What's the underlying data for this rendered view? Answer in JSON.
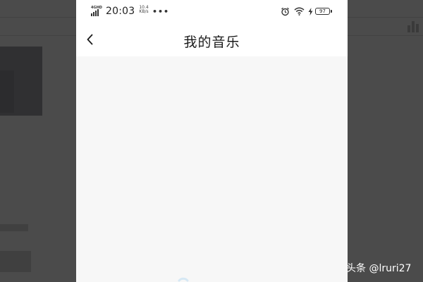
{
  "status_bar": {
    "network_type": "4GHD",
    "time": "20:03",
    "net_speed_value": "10.4",
    "net_speed_unit": "KB/s",
    "more": "•••",
    "battery_level": "97"
  },
  "nav": {
    "title": "我的音乐"
  },
  "watermark": {
    "text": "头条 @lruri27"
  },
  "colors": {
    "background_overlay": "#4b4b4b",
    "page_background": "#f7f7f7",
    "header_background": "#ffffff",
    "title_text": "#1a1a1a"
  },
  "icons": [
    "signal-icon",
    "alarm-icon",
    "wifi-icon",
    "charging-icon",
    "battery-icon",
    "back-arrow-icon",
    "bar-chart-icon"
  ]
}
